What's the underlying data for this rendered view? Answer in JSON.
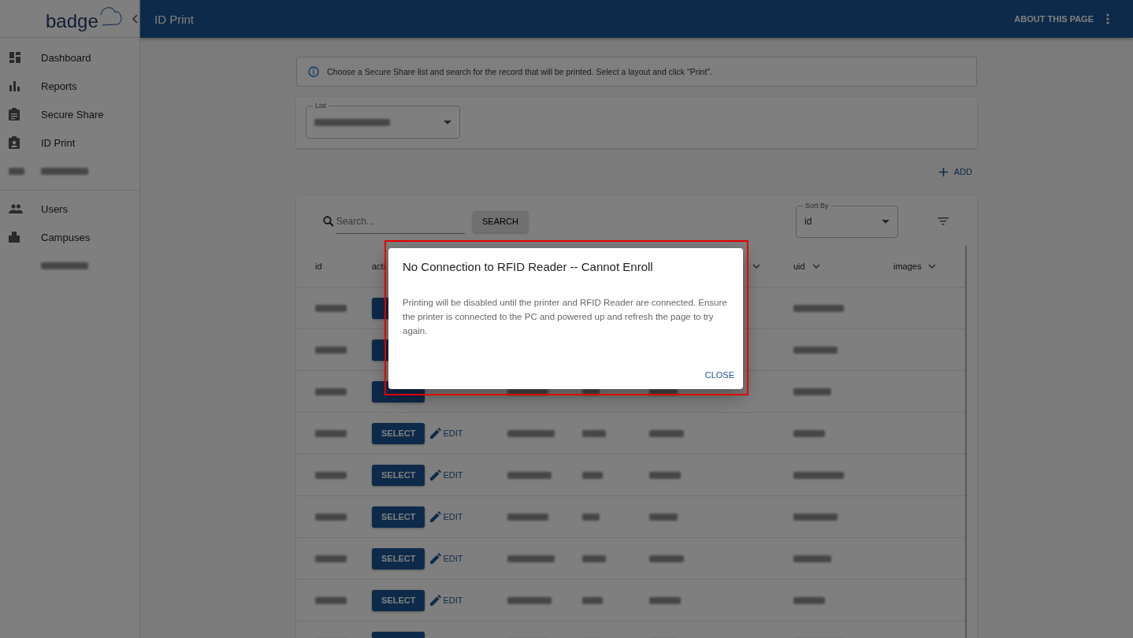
{
  "sidebar": {
    "logo": "badge",
    "groups": [
      {
        "items": [
          {
            "kind": "dashboard",
            "label": "Dashboard"
          },
          {
            "kind": "reports",
            "label": "Reports"
          },
          {
            "kind": "share",
            "label": "Secure Share"
          },
          {
            "kind": "idprint",
            "label": "ID Print"
          },
          {
            "kind": "redacted"
          }
        ]
      },
      {
        "items": [
          {
            "kind": "users",
            "label": "Users"
          },
          {
            "kind": "campuses",
            "label": "Campuses"
          },
          {
            "kind": "redacted-plain"
          }
        ]
      }
    ]
  },
  "header": {
    "title": "ID Print",
    "about": "ABOUT THIS PAGE"
  },
  "info": "Choose a Secure Share list and search for the record that will be printed. Select a layout and click \"Print\".",
  "list_select": {
    "label": "List"
  },
  "add_button": "ADD",
  "search": {
    "placeholder": "Search...",
    "button": "SEARCH"
  },
  "sort_by": {
    "label": "Sort By",
    "value": "id"
  },
  "table": {
    "columns": [
      {
        "kind": "plain",
        "label": "id"
      },
      {
        "kind": "plain",
        "label": "acti"
      },
      {
        "kind": "blank"
      },
      {
        "kind": "blank"
      },
      {
        "kind": "sortable"
      },
      {
        "kind": "sortable",
        "label": "uid"
      },
      {
        "kind": "sortable",
        "label": "images"
      }
    ],
    "rows": [
      {
        "kind": "hidden"
      },
      {
        "kind": "hidden"
      },
      {
        "kind": "covered"
      },
      {
        "kind": "full",
        "select": "SELECT",
        "edit": "EDIT"
      },
      {
        "kind": "full",
        "select": "SELECT",
        "edit": "EDIT"
      },
      {
        "kind": "full",
        "select": "SELECT",
        "edit": "EDIT"
      },
      {
        "kind": "full",
        "select": "SELECT",
        "edit": "EDIT"
      },
      {
        "kind": "full",
        "select": "SELECT",
        "edit": "EDIT"
      },
      {
        "kind": "covered"
      }
    ]
  },
  "dialog": {
    "title": "No Connection to RFID Reader -- Cannot Enroll",
    "message": "Printing will be disabled until the printer and RFID Reader are connected. Ensure the printer is connected to the PC and powered up and refresh the page to try again.",
    "close": "CLOSE",
    "highlighted": true
  }
}
